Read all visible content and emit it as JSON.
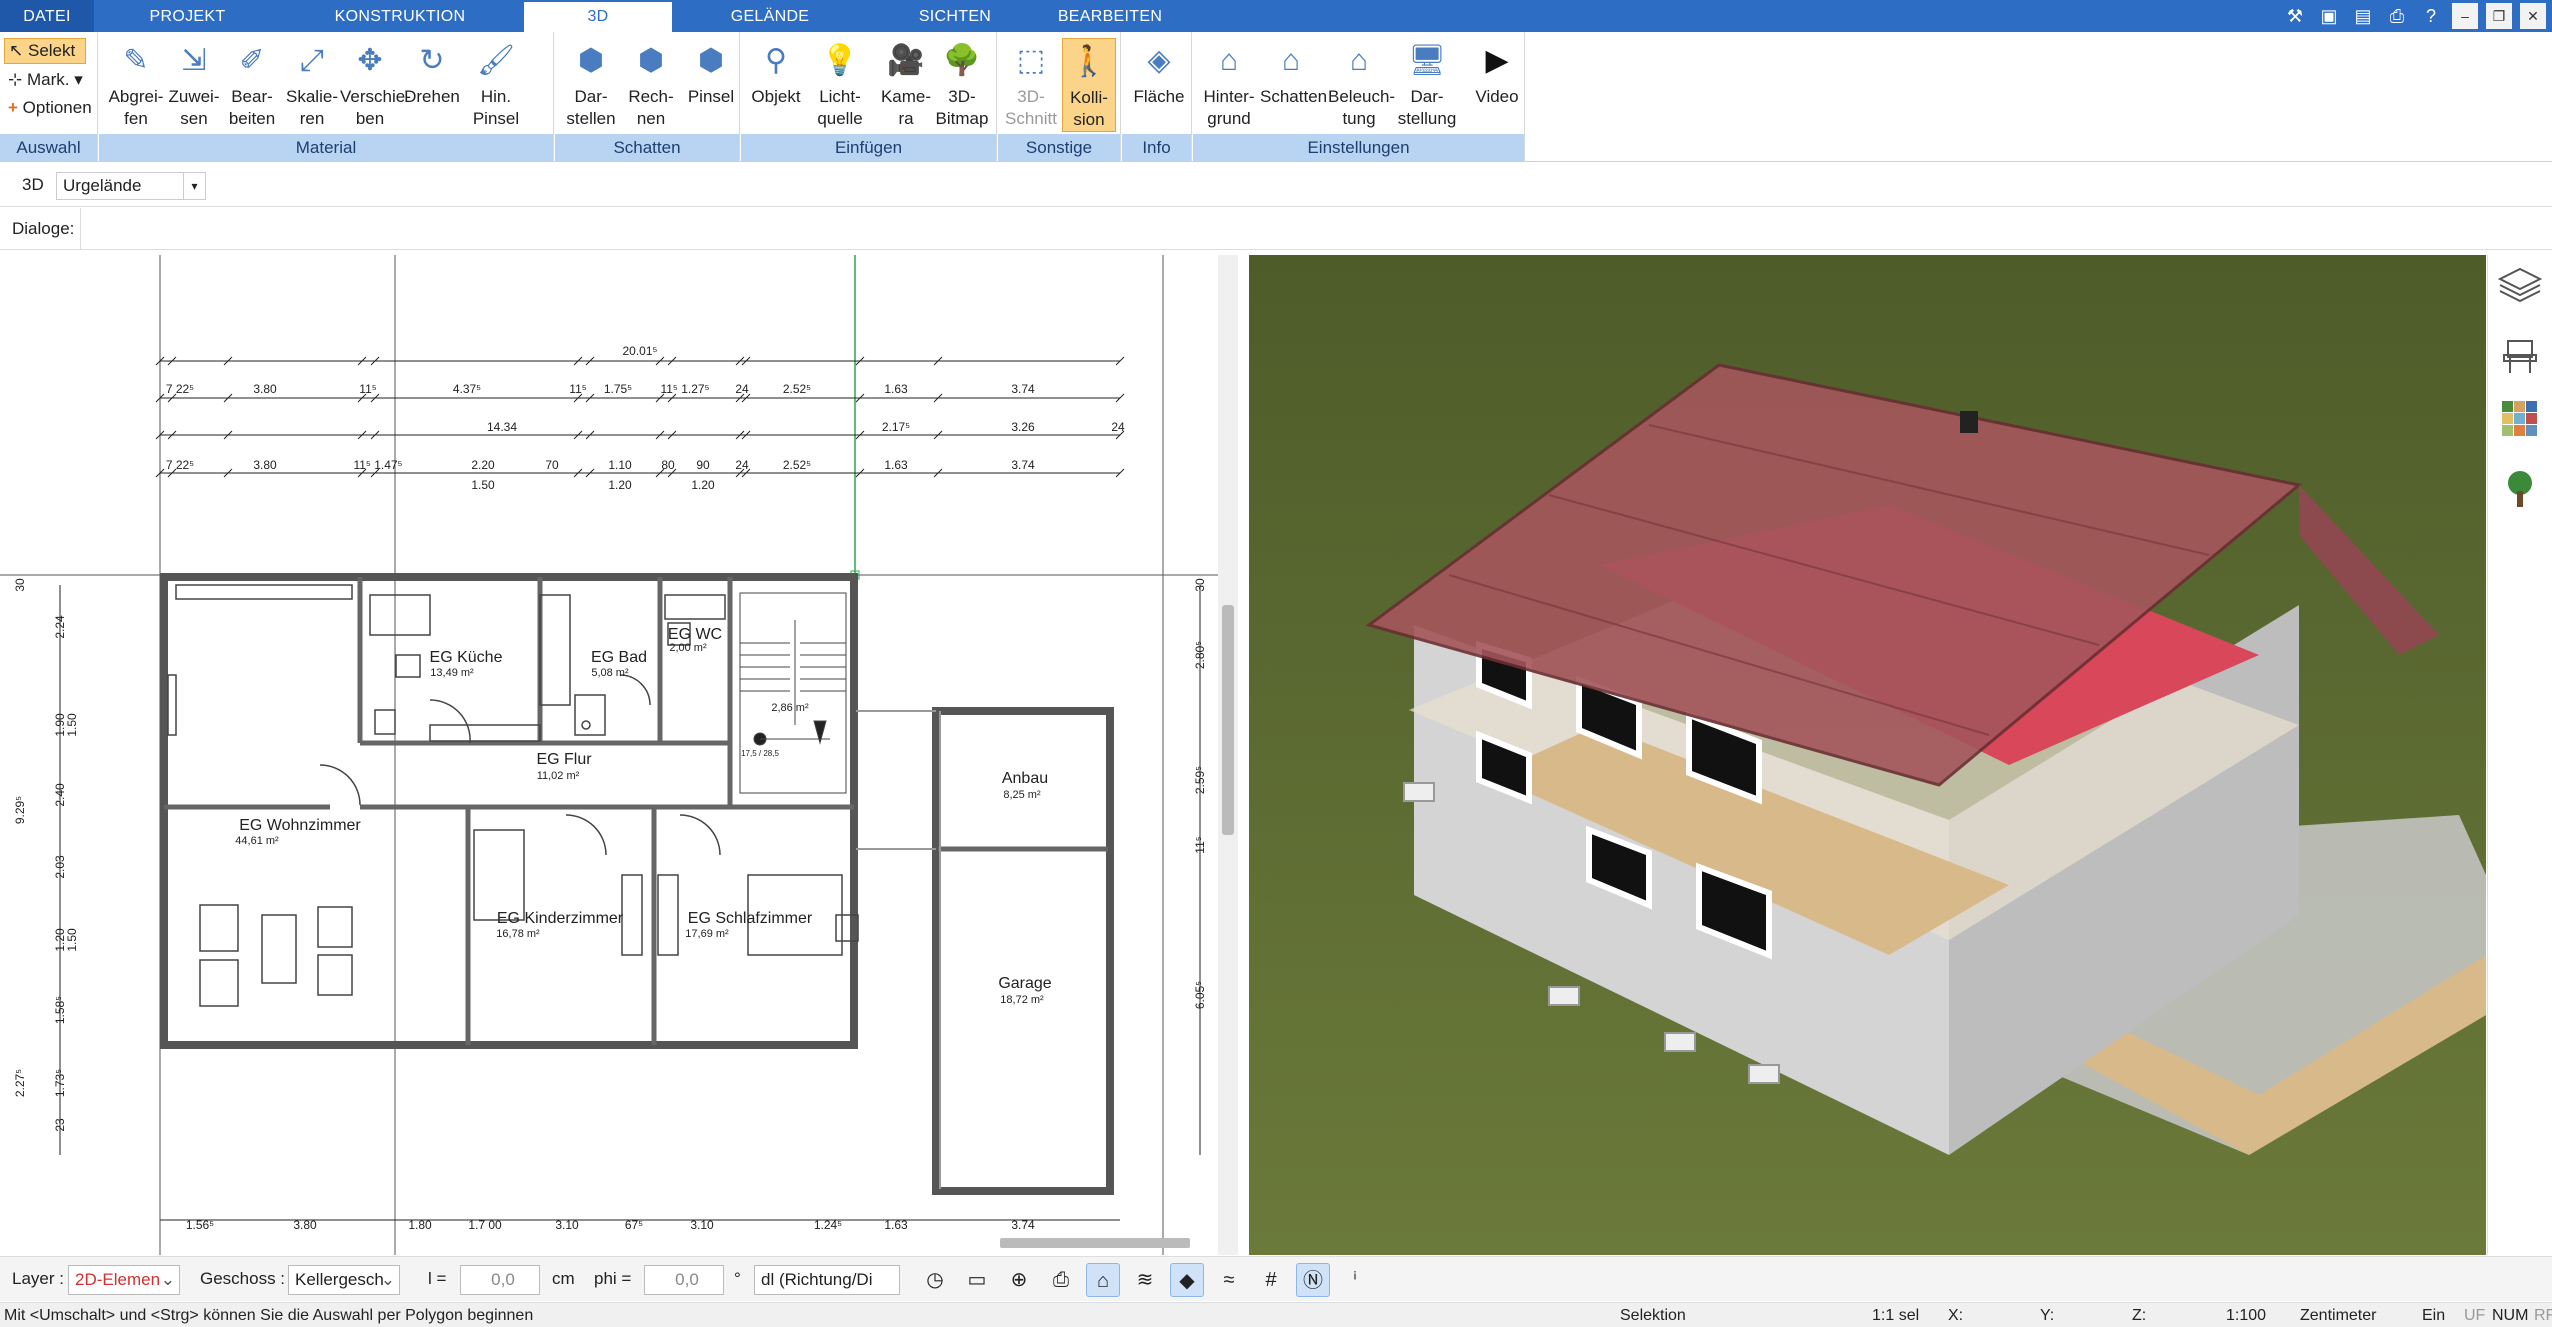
{
  "tabs": [
    {
      "label": "DATEI"
    },
    {
      "label": "PROJEKT"
    },
    {
      "label": "KONSTRUKTION"
    },
    {
      "label": "3D"
    },
    {
      "label": "GELÄNDE"
    },
    {
      "label": "SICHTEN"
    },
    {
      "label": "BEARBEITEN"
    }
  ],
  "ribbon": {
    "auswahl": {
      "select": "Selekt",
      "mark": "Mark.",
      "options": "Optionen",
      "group": "Auswahl"
    },
    "material": {
      "group": "Material",
      "buttons": [
        "Abgrei-\nfen",
        "Zuwei-\nsen",
        "Bear-\nbeiten",
        "Skalie-\nren",
        "Verschie-\nben",
        "Drehen",
        "Hin.\nPinsel"
      ]
    },
    "schatten": {
      "group": "Schatten",
      "buttons": [
        "Dar-\nstellen",
        "Rech-\nnen",
        "Pinsel"
      ]
    },
    "einfuegen": {
      "group": "Einfügen",
      "buttons": [
        "Objekt",
        "Licht-\nquelle",
        "Kame-\nra",
        "3D-\nBitmap"
      ]
    },
    "sonstige": {
      "group": "Sonstige",
      "buttons": [
        "3D-\nSchnitt",
        "Kolli-\nsion"
      ]
    },
    "info": {
      "group": "Info",
      "buttons": [
        "Fläche"
      ]
    },
    "einstellungen": {
      "group": "Einstellungen",
      "buttons": [
        "Hinter-\ngrund",
        "Schatten",
        "Beleuch-\ntung",
        "Dar-\nstellung",
        "Video"
      ]
    }
  },
  "viewbar": {
    "mode": "3D",
    "dropdown_value": "Urgelände",
    "dialogs_label": "Dialoge:"
  },
  "plan": {
    "overall_dim": "20.01⁵",
    "row1": [
      "7 22⁵",
      "3.80",
      "11⁵",
      "4.37⁵",
      "11⁵",
      "1.75⁵",
      "11⁵ 1.27⁵",
      "24",
      "2.52⁵",
      "1.63",
      "3.74"
    ],
    "row2": [
      "14.34",
      "2.17⁵",
      "3.26",
      "24"
    ],
    "row3": [
      "7 22⁵",
      "3.80",
      "11⁵ 1.47⁵",
      "2.20",
      "70",
      "1.10",
      "80",
      "90",
      "24",
      "2.52⁵",
      "1.63",
      "3.74"
    ],
    "row3_sub": [
      "1.50",
      "1.20",
      "1.20"
    ],
    "left_dims": [
      "30",
      "2.24",
      "1.90",
      "1.50",
      "2.40",
      "9.29⁵",
      "2.03",
      "1.20",
      "1.50",
      "1.58⁵",
      "1.73⁵",
      "2.27⁵",
      "23"
    ],
    "right_dims": [
      "30",
      "2.80⁵",
      "2.59⁵",
      "11⁵",
      "6.05⁵"
    ],
    "bottom_dims": [
      "1.56⁵",
      "3.80",
      "1.80",
      "1.7 00",
      "3.10",
      "67⁵",
      "3.10",
      "1.24⁵",
      "1.63",
      "3.74"
    ],
    "rooms": [
      {
        "name": "EG Küche",
        "area": "13,49 m²"
      },
      {
        "name": "EG Bad",
        "area": "5,08 m²"
      },
      {
        "name": "EG WC",
        "area": "2,00 m²"
      },
      {
        "name": "2,86 m²",
        "area": "17,5 / 28,5"
      },
      {
        "name": "EG Flur",
        "area": "11,02 m²"
      },
      {
        "name": "EG Wohnzimmer",
        "area": "44,61 m²"
      },
      {
        "name": "EG Kinderzimmer",
        "area": "16,78 m²"
      },
      {
        "name": "EG Schlafzimmer",
        "area": "17,69 m²"
      },
      {
        "name": "Anbau",
        "area": "8,25 m²"
      },
      {
        "name": "Garage",
        "area": "18,72 m²"
      }
    ]
  },
  "bottombar": {
    "layer_label": "Layer :",
    "layer_value": "2D-Elemen",
    "floor_label": "Geschoss :",
    "floor_value": "Kellergesch",
    "l_label": "l =",
    "l_value": "0,0",
    "l_unit": "cm",
    "phi_label": "phi =",
    "phi_value": "0,0",
    "phi_unit": "°",
    "dir_value": "dl (Richtung/Di"
  },
  "statusbar": {
    "hint": "Mit <Umschalt> und <Strg> können Sie die Auswahl per Polygon beginnen",
    "mode": "Selektion",
    "sel": "1:1 sel",
    "x": "X:",
    "y": "Y:",
    "z": "Z:",
    "scale": "1:100",
    "unit": "Zentimeter",
    "ein": "Ein",
    "uf": "UF",
    "num": "NUM",
    "rf": "RF"
  },
  "colors": {
    "tab_blue": "#2e6dc4",
    "group_label": "#b9d3f3",
    "highlight": "#fbd489",
    "grass": "#5b6b30",
    "roof": "#a4565b",
    "floor_red": "#d8475a"
  }
}
